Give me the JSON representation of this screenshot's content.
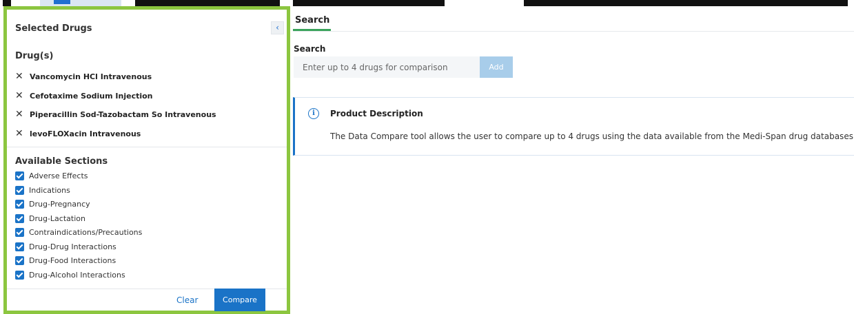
{
  "left_panel": {
    "title": "Selected Drugs",
    "collapse_icon": "chevron-left-icon",
    "drugs_heading": "Drug(s)",
    "drugs": [
      "Vancomycin HCl Intravenous",
      "Cefotaxime Sodium Injection",
      "Piperacillin Sod-Tazobactam So Intravenous",
      "levoFLOXacin Intravenous"
    ],
    "sections_heading": "Available Sections",
    "sections": [
      {
        "label": "Adverse Effects",
        "checked": true
      },
      {
        "label": "Indications",
        "checked": true
      },
      {
        "label": "Drug-Pregnancy",
        "checked": true
      },
      {
        "label": "Drug-Lactation",
        "checked": true
      },
      {
        "label": "Contraindications/Precautions",
        "checked": true
      },
      {
        "label": "Drug-Drug Interactions",
        "checked": true
      },
      {
        "label": "Drug-Food Interactions",
        "checked": true
      },
      {
        "label": "Drug-Alcohol Interactions",
        "checked": true
      }
    ],
    "clear_label": "Clear",
    "compare_label": "Compare"
  },
  "main": {
    "tab_label": "Search",
    "search_label": "Search",
    "search_placeholder": "Enter up to 4 drugs for comparison",
    "add_label": "Add",
    "description_title": "Product Description",
    "description_text": "The Data Compare tool allows the user to compare up to 4 drugs using the data available from the Medi-Span drug databases."
  },
  "colors": {
    "highlight_border": "#8cc63f",
    "accent_blue": "#1a73c7",
    "tab_underline": "#3aa35b"
  }
}
